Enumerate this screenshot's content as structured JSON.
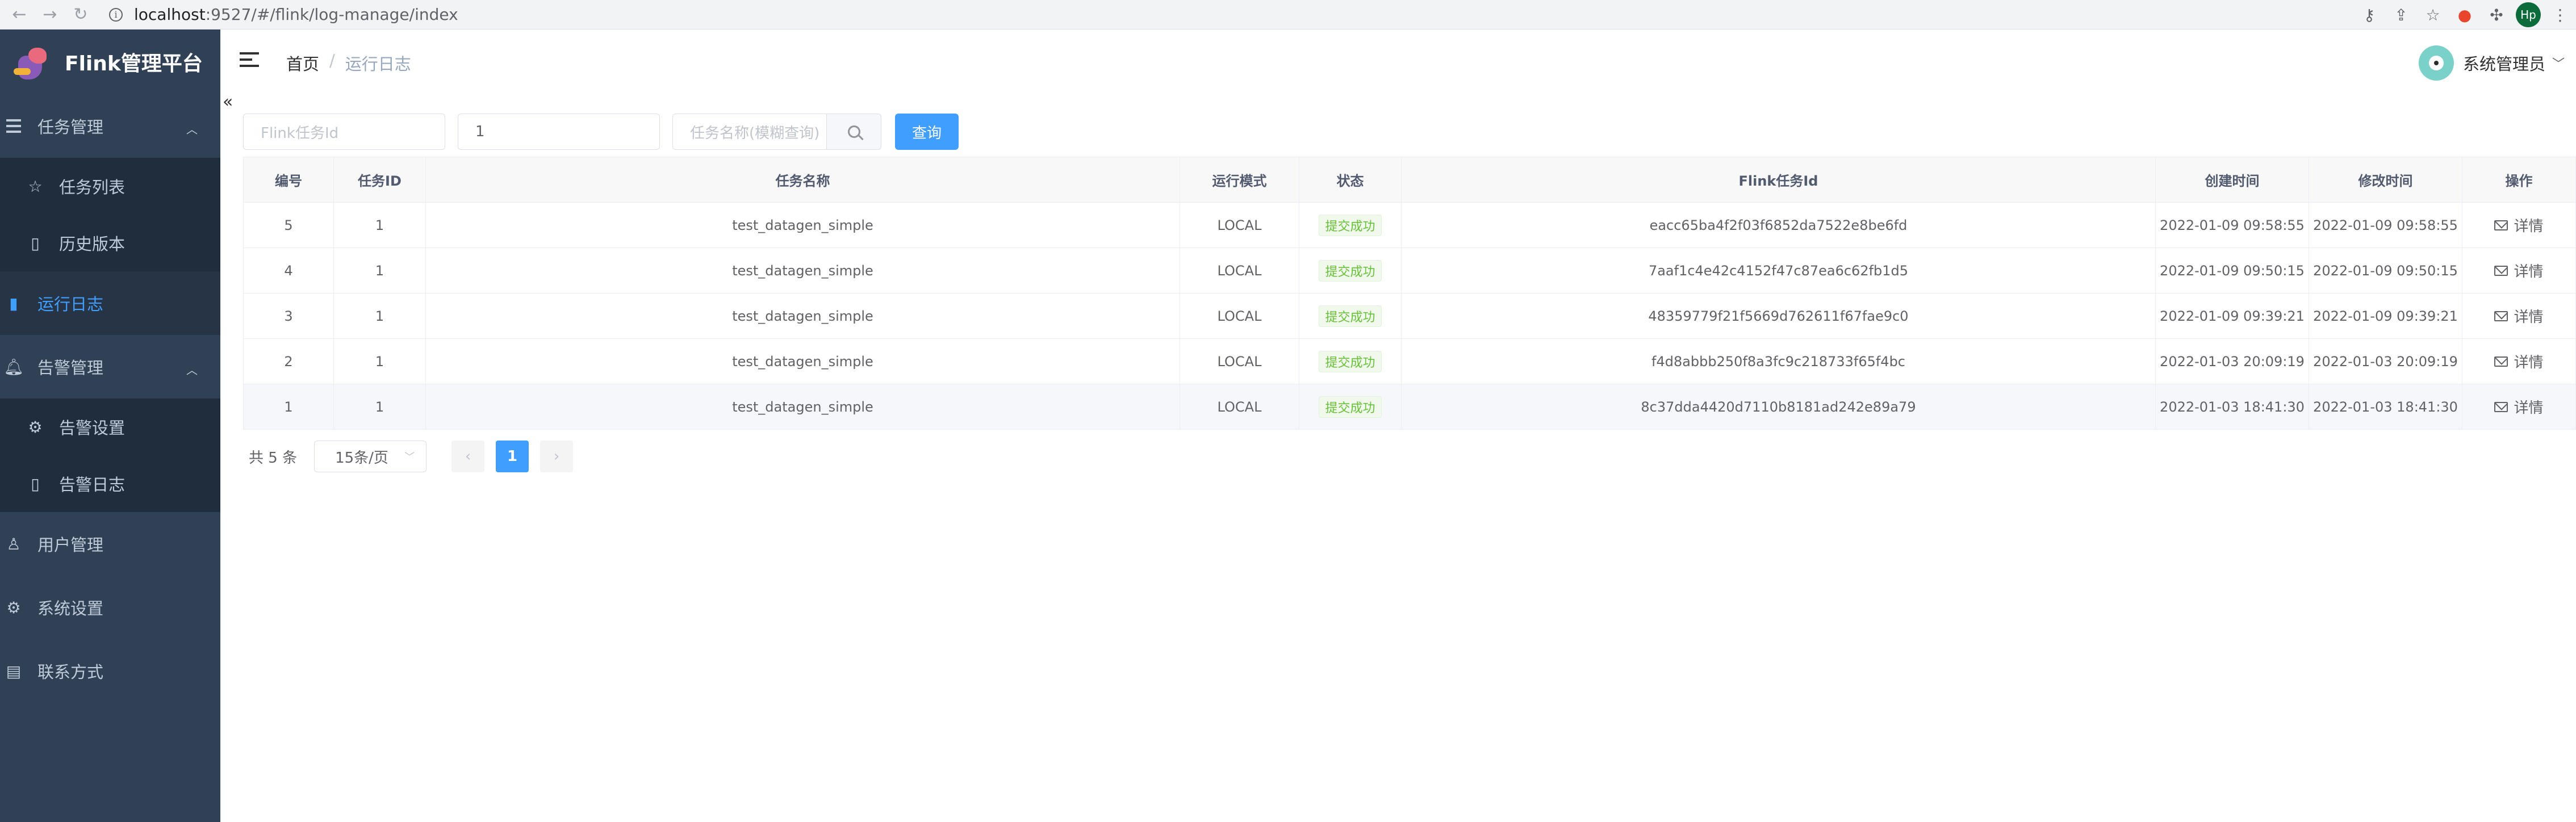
{
  "browser": {
    "url_host": "localhost",
    "url_path": ":9527/#/flink/log-manage/index",
    "profile_initials": "Hp"
  },
  "sidebar": {
    "brand": "Flink管理平台",
    "items": [
      {
        "label": "任务管理",
        "icon": "list-icon",
        "type": "group"
      },
      {
        "label": "任务列表",
        "icon": "star-icon",
        "type": "sub"
      },
      {
        "label": "历史版本",
        "icon": "document-icon",
        "type": "sub"
      },
      {
        "label": "运行日志",
        "icon": "document-filled-icon",
        "type": "active"
      },
      {
        "label": "告警管理",
        "icon": "bell-icon",
        "type": "group"
      },
      {
        "label": "告警设置",
        "icon": "gear-icon",
        "type": "sub"
      },
      {
        "label": "告警日志",
        "icon": "document-icon",
        "type": "sub"
      },
      {
        "label": "用户管理",
        "icon": "user-icon",
        "type": "top"
      },
      {
        "label": "系统设置",
        "icon": "settings-icon",
        "type": "top"
      },
      {
        "label": "联系方式",
        "icon": "contact-icon",
        "type": "top"
      }
    ]
  },
  "header": {
    "breadcrumb_home": "首页",
    "breadcrumb_sep": "/",
    "breadcrumb_current": "运行日志",
    "user_name": "系统管理员"
  },
  "filters": {
    "flink_job_id_placeholder": "Flink任务Id",
    "job_id_value": "1",
    "job_name_placeholder": "任务名称(模糊查询)",
    "query_label": "查询"
  },
  "table": {
    "columns": [
      "编号",
      "任务ID",
      "任务名称",
      "运行模式",
      "状态",
      "Flink任务Id",
      "创建时间",
      "修改时间",
      "操作"
    ],
    "rows": [
      [
        "5",
        "1",
        "test_datagen_simple",
        "LOCAL",
        "提交成功",
        "eacc65ba4f2f03f6852da7522e8be6fd",
        "2022-01-09 09:58:55",
        "2022-01-09 09:58:55",
        "详情"
      ],
      [
        "4",
        "1",
        "test_datagen_simple",
        "LOCAL",
        "提交成功",
        "7aaf1c4e42c4152f47c87ea6c62fb1d5",
        "2022-01-09 09:50:15",
        "2022-01-09 09:50:15",
        "详情"
      ],
      [
        "3",
        "1",
        "test_datagen_simple",
        "LOCAL",
        "提交成功",
        "48359779f21f5669d762611f67fae9c0",
        "2022-01-09 09:39:21",
        "2022-01-09 09:39:21",
        "详情"
      ],
      [
        "2",
        "1",
        "test_datagen_simple",
        "LOCAL",
        "提交成功",
        "f4d8abbb250f8a3fc9c218733f65f4bc",
        "2022-01-03 20:09:19",
        "2022-01-03 20:09:19",
        "详情"
      ],
      [
        "1",
        "1",
        "test_datagen_simple",
        "LOCAL",
        "提交成功",
        "8c37dda4420d7110b8181ad242e89a79",
        "2022-01-03 18:41:30",
        "2022-01-03 18:41:30",
        "详情"
      ]
    ]
  },
  "pagination": {
    "total": "共 5 条",
    "page_size": "15条/页",
    "current_page": "1"
  },
  "colors": {
    "sidebar_bg": "#304156",
    "submenu_bg": "#1f2d3d",
    "primary": "#409eff",
    "success": "#67c23a"
  }
}
